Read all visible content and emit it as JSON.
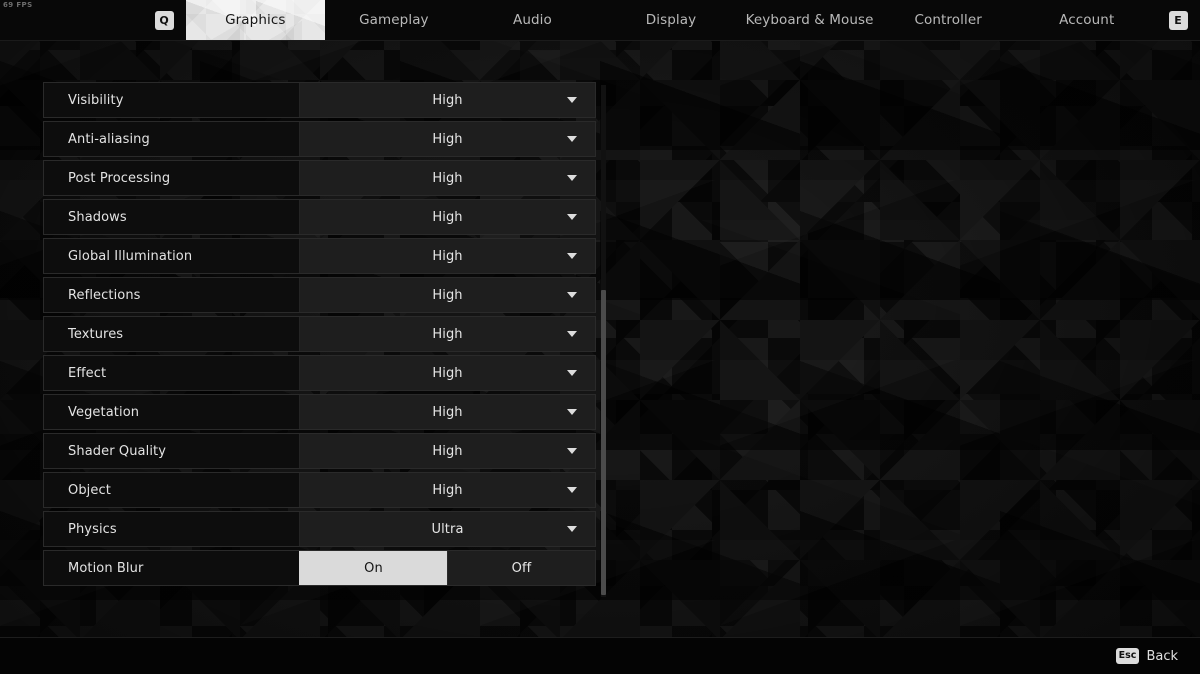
{
  "hud": {
    "fps": "69 FPS"
  },
  "topbar": {
    "prev_key": "Q",
    "next_key": "E",
    "tabs": [
      {
        "label": "Graphics",
        "active": true
      },
      {
        "label": "Gameplay",
        "active": false
      },
      {
        "label": "Audio",
        "active": false
      },
      {
        "label": "Display",
        "active": false
      },
      {
        "label": "Keyboard & Mouse",
        "active": false
      },
      {
        "label": "Controller",
        "active": false
      },
      {
        "label": "Account",
        "active": false
      }
    ]
  },
  "settings": {
    "rows": [
      {
        "label": "Visibility",
        "type": "dropdown",
        "value": "High"
      },
      {
        "label": "Anti-aliasing",
        "type": "dropdown",
        "value": "High"
      },
      {
        "label": "Post Processing",
        "type": "dropdown",
        "value": "High"
      },
      {
        "label": "Shadows",
        "type": "dropdown",
        "value": "High"
      },
      {
        "label": "Global Illumination",
        "type": "dropdown",
        "value": "High"
      },
      {
        "label": "Reflections",
        "type": "dropdown",
        "value": "High"
      },
      {
        "label": "Textures",
        "type": "dropdown",
        "value": "High"
      },
      {
        "label": "Effect",
        "type": "dropdown",
        "value": "High"
      },
      {
        "label": "Vegetation",
        "type": "dropdown",
        "value": "High"
      },
      {
        "label": "Shader Quality",
        "type": "dropdown",
        "value": "High"
      },
      {
        "label": "Object",
        "type": "dropdown",
        "value": "High"
      },
      {
        "label": "Physics",
        "type": "dropdown",
        "value": "Ultra"
      },
      {
        "label": "Motion Blur",
        "type": "toggle",
        "options": [
          "On",
          "Off"
        ],
        "selected": "On"
      }
    ]
  },
  "bottombar": {
    "back_key": "Esc",
    "back_label": "Back"
  },
  "colors": {
    "accent_light": "#dadada",
    "row_bg": "#101010",
    "control_bg": "#1e1e1e",
    "text": "#e6e6e6",
    "scrollbar": "#4b4b4b"
  }
}
